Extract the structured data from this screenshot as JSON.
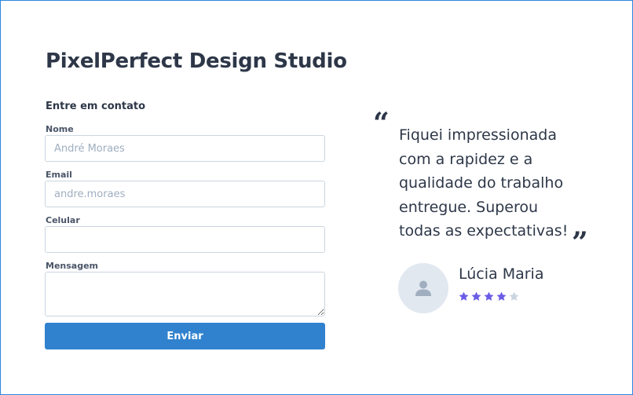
{
  "page": {
    "title": "PixelPerfect Design Studio"
  },
  "form": {
    "heading": "Entre em contato",
    "name_label": "Nome",
    "name_placeholder": "André Moraes",
    "name_value": "",
    "email_label": "Email",
    "email_placeholder": "andre.moraes",
    "email_value": "",
    "phone_label": "Celular",
    "phone_placeholder": "",
    "phone_value": "",
    "message_label": "Mensagem",
    "message_value": "",
    "submit_label": "Enviar"
  },
  "testimonial": {
    "open_quote": "“",
    "close_quote": "”",
    "text": "Fiquei impressionada com a rapidez e a qualidade do trabalho entregue. Superou todas as expectativas!",
    "author": "Lúcia Maria",
    "avatar_icon": "user-icon",
    "rating": 4,
    "rating_max": 5
  },
  "colors": {
    "accent": "#3182ce",
    "frame_border": "#2e86de",
    "star_filled": "#6b5ce7",
    "star_empty": "#cbd5e0",
    "text": "#2d3748"
  }
}
